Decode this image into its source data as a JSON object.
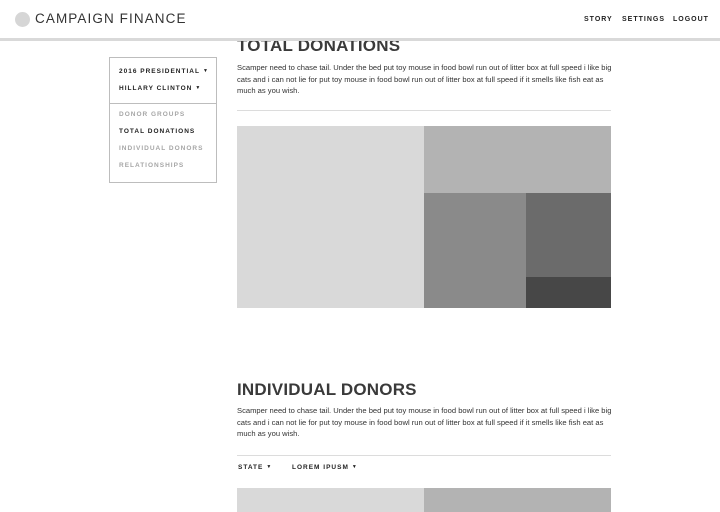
{
  "header": {
    "brand": "CAMPAIGN FINANCE",
    "nav": [
      "STORY",
      "SETTINGS",
      "LOGOUT"
    ]
  },
  "sidebar": {
    "election_select": "2016 PRESIDENTIAL",
    "candidate_select": "HILLARY CLINTON",
    "items": [
      {
        "label": "DONOR GROUPS",
        "active": false
      },
      {
        "label": "TOTAL DONATIONS",
        "active": true
      },
      {
        "label": "INDIVIDUAL DONORS",
        "active": false
      },
      {
        "label": "RELATIONSHIPS",
        "active": false
      }
    ]
  },
  "sections": {
    "total_donations": {
      "title": "TOTAL DONATIONS",
      "body": "Scamper need to chase tail. Under the bed put toy mouse in food bowl run out of litter box at full speed i like big cats and i can not lie for put toy mouse in food bowl run out of litter box at full speed if it smells like fish eat as much as you wish."
    },
    "individual_donors": {
      "title": "INDIVIDUAL DONORS",
      "body": "Scamper need to chase tail. Under the bed put toy mouse in food bowl run out of litter box at full speed i like big cats and i can not lie for put toy mouse in food bowl run out of litter box at full speed if it smells like fish eat as much as you wish.",
      "filters": [
        "STATE",
        "LOREM IPUSM"
      ]
    }
  },
  "colors": {
    "block_light": "#d9d9d9",
    "block_mid": "#b3b3b3",
    "block_dark": "#8a8a8a",
    "block_darker": "#6b6b6b",
    "block_darkest": "#474747"
  }
}
